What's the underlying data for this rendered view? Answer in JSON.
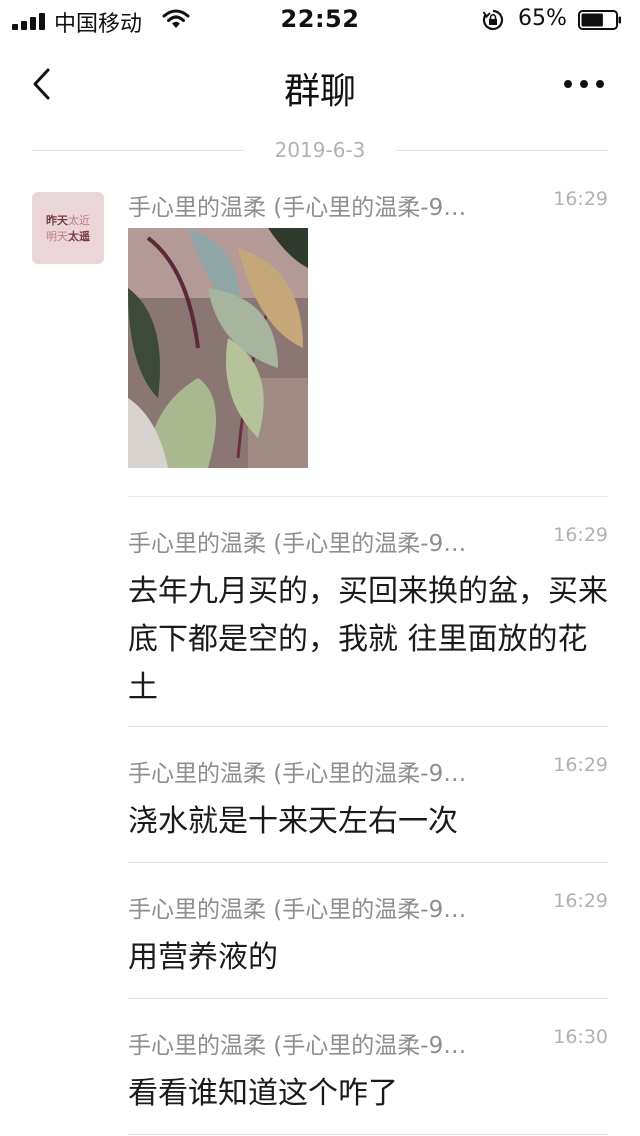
{
  "status_bar": {
    "carrier": "中国移动",
    "time": "22:52",
    "battery_percent": "65%",
    "battery_level": 0.65,
    "icons": [
      "signal-icon",
      "wifi-icon",
      "rotation-lock-icon",
      "battery-icon"
    ]
  },
  "nav": {
    "back_icon": "chevron-left-icon",
    "title": "群聊",
    "more_icon": "more-icon"
  },
  "date_separator": "2019-6-3",
  "avatar": {
    "line1_a": "昨天",
    "line1_b": "太近",
    "line2_a": "明天",
    "line2_b": "太遥"
  },
  "messages": [
    {
      "sender": "手心里的温柔 (手心里的温柔-9…",
      "time": "16:29",
      "type": "image"
    },
    {
      "sender": "手心里的温柔 (手心里的温柔-9…",
      "time": "16:29",
      "type": "text",
      "text": "去年九月买的，买回来换的盆，买来底下都是空的，我就 往里面放的花土"
    },
    {
      "sender": "手心里的温柔 (手心里的温柔-9…",
      "time": "16:29",
      "type": "text",
      "text": "浇水就是十来天左右一次"
    },
    {
      "sender": "手心里的温柔 (手心里的温柔-9…",
      "time": "16:29",
      "type": "text",
      "text": "用营养液的"
    },
    {
      "sender": "手心里的温柔 (手心里的温柔-9…",
      "time": "16:30",
      "type": "text",
      "text": "看看谁知道这个咋了"
    }
  ]
}
